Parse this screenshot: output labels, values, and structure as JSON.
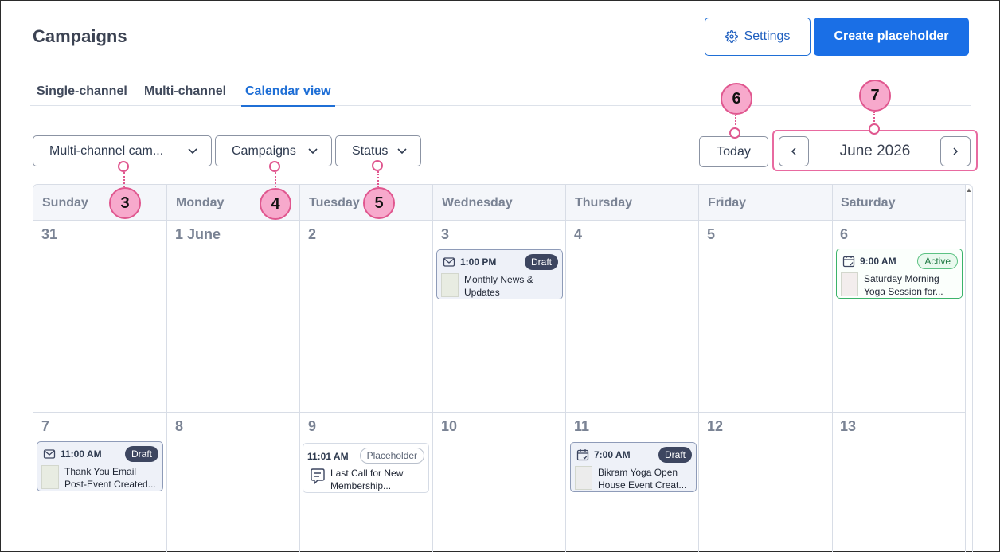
{
  "page": {
    "title": "Campaigns",
    "settings_label": "Settings",
    "create_label": "Create placeholder"
  },
  "tabs": [
    "Single-channel",
    "Multi-channel",
    "Calendar view"
  ],
  "filters": {
    "channel": "Multi-channel cam...",
    "campaigns": "Campaigns",
    "status": "Status"
  },
  "nav": {
    "today": "Today",
    "month": "June 2026"
  },
  "callouts": [
    "3",
    "4",
    "5",
    "6",
    "7"
  ],
  "days": [
    "Sunday",
    "Monday",
    "Tuesday",
    "Wednesday",
    "Thursday",
    "Friday",
    "Saturday"
  ],
  "weeks": [
    [
      "31",
      "1 June",
      "2",
      "3",
      "4",
      "5",
      "6"
    ],
    [
      "7",
      "8",
      "9",
      "10",
      "11",
      "12",
      "13"
    ]
  ],
  "events": [
    {
      "time": "1:00 PM",
      "badge": "Draft",
      "title1": "Monthly News &",
      "title2": "Updates",
      "icon": "mail-icon"
    },
    {
      "time": "9:00 AM",
      "badge": "Active",
      "title1": "Saturday Morning",
      "title2": "Yoga Session for...",
      "icon": "calendar-check-icon"
    },
    {
      "time": "11:00 AM",
      "badge": "Draft",
      "title1": "Thank You Email",
      "title2": "Post-Event Created...",
      "icon": "mail-icon"
    },
    {
      "time": "11:01 AM",
      "badge": "Placeholder",
      "title1": "Last Call for New",
      "title2": "Membership...",
      "icon": "note-icon"
    },
    {
      "time": "7:00 AM",
      "badge": "Draft",
      "title1": "Bikram Yoga Open",
      "title2": "House Event Creat...",
      "icon": "calendar-check-icon"
    }
  ]
}
